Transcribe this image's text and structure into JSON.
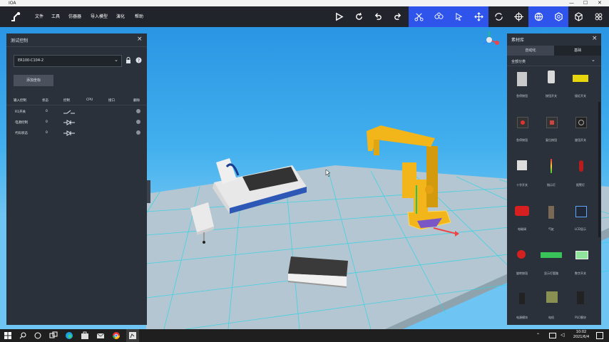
{
  "window": {
    "title": "IOA",
    "min": "—",
    "max": "☐",
    "close": "✕"
  },
  "menu": {
    "items": [
      "文件",
      "工具",
      "仿器器",
      "导入模型",
      "演化",
      "帮助"
    ]
  },
  "toolbar": {
    "buttons": [
      {
        "name": "play-icon",
        "active": false
      },
      {
        "name": "redo-icon",
        "active": false
      },
      {
        "name": "undo-icon",
        "active": false
      },
      {
        "name": "redo-arrow-icon",
        "active": false
      },
      {
        "name": "scissors-icon",
        "active": true
      },
      {
        "name": "robot-icon",
        "active": true
      },
      {
        "name": "cursor-icon",
        "active": true
      },
      {
        "name": "move-icon",
        "active": true
      },
      {
        "name": "rotate-icon",
        "active": false
      },
      {
        "name": "crosshair-icon",
        "active": false
      },
      {
        "name": "globe-icon",
        "active": true
      },
      {
        "name": "gear-icon",
        "active": true
      },
      {
        "name": "cube-icon",
        "active": false
      },
      {
        "name": "grid-icon",
        "active": false
      }
    ]
  },
  "left_panel": {
    "title": "测试控制",
    "close": "×",
    "device": "ER100-C104-2",
    "add_button": "添加坐标",
    "columns": [
      "输入控制",
      "状态",
      "控制",
      "CPU",
      "接口",
      "删除"
    ],
    "rows": [
      {
        "name": "R1开关",
        "state": "0"
      },
      {
        "name": "电源控制",
        "state": "0"
      },
      {
        "name": "代码状态",
        "state": "0"
      }
    ]
  },
  "right_panel": {
    "title": "素材库",
    "close": "×",
    "tabs": [
      "自动化",
      "基础"
    ],
    "category": "全部分类",
    "items": [
      "急停按钮",
      "按钮开关",
      "接近开关",
      "急停按钮",
      "复位按钮",
      "旋钮开关",
      "十字开关",
      "指示灯",
      "报警灯",
      "电磁阀",
      "气缸",
      "LCD显示",
      "旋转按钮",
      "显示灯管路",
      "数字开关",
      "电源模块",
      "电机",
      "PLC模块"
    ]
  },
  "taskbar": {
    "time": "10:02",
    "date": "2021/6/4"
  },
  "colors": {
    "accent": "#2f54eb",
    "robot": "#f2b51a",
    "sky_top": "#2a95e4",
    "floor": "#b4c6d1",
    "grid": "#2fd4e6"
  }
}
